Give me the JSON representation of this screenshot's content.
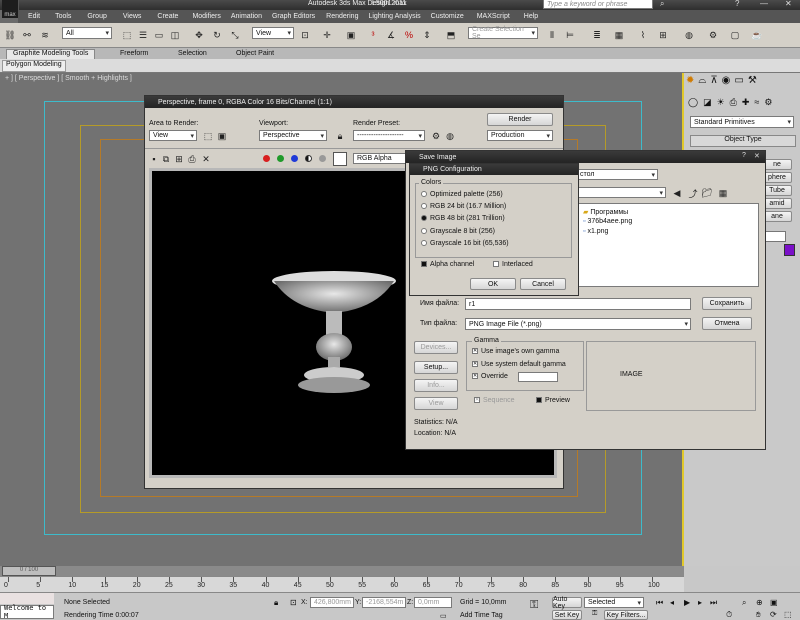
{
  "app": {
    "title": "Autodesk 3ds Max Design 2011",
    "file": "L5001.max",
    "search_placeholder": "Type a keyword or phrase"
  },
  "menu": [
    "Edit",
    "Tools",
    "Group",
    "Views",
    "Create",
    "Modifiers",
    "Animation",
    "Graph Editors",
    "Rendering",
    "Lighting Analysis",
    "Customize",
    "MAXScript",
    "Help"
  ],
  "toolbar": {
    "selection_filter": "All",
    "ref_coord": "View",
    "named_selection": "Create Selection Se"
  },
  "ribbon": {
    "tabs": [
      "Graphite Modeling Tools",
      "Freeform",
      "Selection",
      "Object Paint"
    ],
    "sub_tab": "Polygon Modeling"
  },
  "viewport": {
    "label": "+ ] [ Perspective ] [ Smooth + Highlights ]"
  },
  "render_frame": {
    "title": "Perspective, frame 0, RGBA Color 16 Bits/Channel (1:1)",
    "area_label": "Area to Render:",
    "area_value": "View",
    "viewport_label": "Viewport:",
    "viewport_value": "Perspective",
    "preset_label": "Render Preset:",
    "preset_value": "--------------------",
    "render_button": "Render",
    "production_value": "Production",
    "channel_value": "RGB Alpha",
    "colors": {
      "red": "#d81f1f",
      "green": "#1f9a2a",
      "blue": "#1f3ad8"
    }
  },
  "save_image": {
    "title": "Save Image",
    "path_value": "стол",
    "files": [
      {
        "name": "Программы",
        "icon": "folder-icon"
      },
      {
        "name": "376b4aee.png",
        "icon": "png-file-icon"
      },
      {
        "name": "x1.png",
        "icon": "png-file-icon"
      }
    ],
    "filename_label": "Имя файла:",
    "filename_value": "r1",
    "filetype_label": "Тип файла:",
    "filetype_value": "PNG Image File (*.png)",
    "save_button": "Сохранить",
    "cancel_button": "Отмена",
    "devices_button": "Devices...",
    "setup_button": "Setup...",
    "info_button": "Info...",
    "view_button": "View",
    "gamma_label": "Gamma",
    "gamma_options": [
      "Use image's own gamma",
      "Use system default gamma",
      "Override"
    ],
    "sequence_label": "Sequence",
    "preview_label": "Preview",
    "image_label": "IMAGE",
    "statistics": "Statistics: N/A",
    "location": "Location: N/A"
  },
  "png_config": {
    "title": "PNG Configuration",
    "colors_label": "Colors",
    "options": [
      {
        "label": "Optimized palette  (256)",
        "selected": false
      },
      {
        "label": "RGB 24 bit  (16.7 Million)",
        "selected": false
      },
      {
        "label": "RGB 48 bit  (281 Trillion)",
        "selected": true
      },
      {
        "label": "Grayscale 8 bit  (256)",
        "selected": false
      },
      {
        "label": "Grayscale 16 bit  (65,536)",
        "selected": false
      }
    ],
    "alpha_label": "Alpha channel",
    "interlaced_label": "Interlaced",
    "ok_button": "OK",
    "cancel_button": "Cancel"
  },
  "command_panel": {
    "category_value": "Standard Primitives",
    "rollout_title": "Object Type",
    "object_buttons": [
      "ne",
      "phere",
      "Tube",
      "amid",
      "ane"
    ],
    "swatch_color": "#7a10c8"
  },
  "timeline": {
    "frame_counter": "0 / 100",
    "ticks": [
      "0",
      "5",
      "10",
      "15",
      "20",
      "25",
      "30",
      "35",
      "40",
      "45",
      "50",
      "55",
      "60",
      "65",
      "70",
      "75",
      "80",
      "85",
      "90",
      "95",
      "100"
    ]
  },
  "status": {
    "maxscript_text": "Welcome to M",
    "selection_text": "None Selected",
    "rendering_time": "Rendering Time  0:00:07",
    "x_label": "X:",
    "x_value": "426,800mm",
    "y_label": "Y:",
    "y_value": "-2168,554m",
    "z_label": "Z:",
    "z_value": "0,0mm",
    "grid_text": "Grid = 10,0mm",
    "add_time_tag": "Add Time Tag",
    "auto_key": "Auto Key",
    "set_key": "Set Key",
    "selected_value": "Selected",
    "key_filters": "Key Filters..."
  }
}
